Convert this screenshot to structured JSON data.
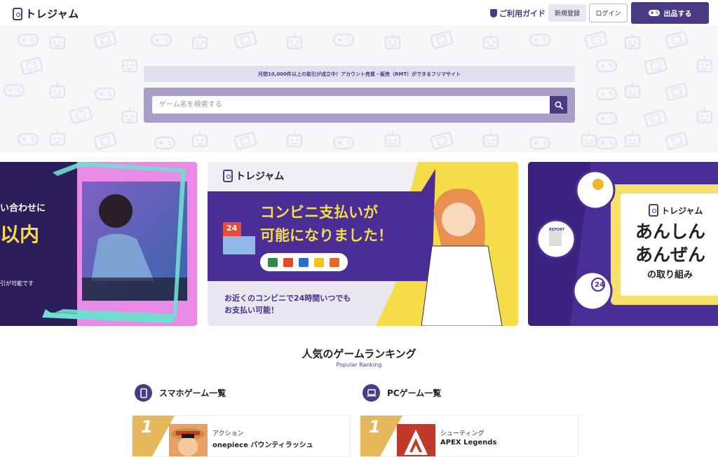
{
  "header": {
    "logo_text": "トレジャム",
    "guide_label": "ご利用ガイド",
    "register_label": "新規登録",
    "login_label": "ログイン",
    "sell_label": "出品する"
  },
  "hero": {
    "tagline": "月間10,000件以上の取引が成立中！アカウント売買・販売（RMT）ができるフリマサイト",
    "search_placeholder": "ゲーム名を検索する"
  },
  "banners": {
    "left": {
      "line1": "い合わせに",
      "line2": "以内",
      "line3": "引が可能です"
    },
    "center": {
      "logo_text": "トレジャム",
      "headline1": "コンビニ支払いが",
      "headline2": "可能になりました！",
      "badge": "24",
      "sub1": "お近くのコンビニで24時間いつでも",
      "sub2": "お支払い可能！"
    },
    "right": {
      "logo_text": "トレジャム",
      "line1": "あんしん",
      "line2": "あんぜん",
      "line3": "の取り組み",
      "report_label": "REPORT",
      "clock_label": "24"
    }
  },
  "ranking": {
    "title": "人気のゲームランキング",
    "subtitle": "Popular Ranking",
    "sections": [
      {
        "label": "スマホゲーム一覧",
        "items": [
          {
            "rank": "1",
            "genre": "アクション",
            "name": "onepiece バウンティラッシュ"
          }
        ]
      },
      {
        "label": "PCゲーム一覧",
        "items": [
          {
            "rank": "1",
            "genre": "シューティング",
            "name": "APEX Legends"
          }
        ]
      }
    ]
  },
  "colors": {
    "brand": "#4b3a85",
    "accent_yellow": "#f5dd4a",
    "rank_gold": "#e5b95b"
  }
}
